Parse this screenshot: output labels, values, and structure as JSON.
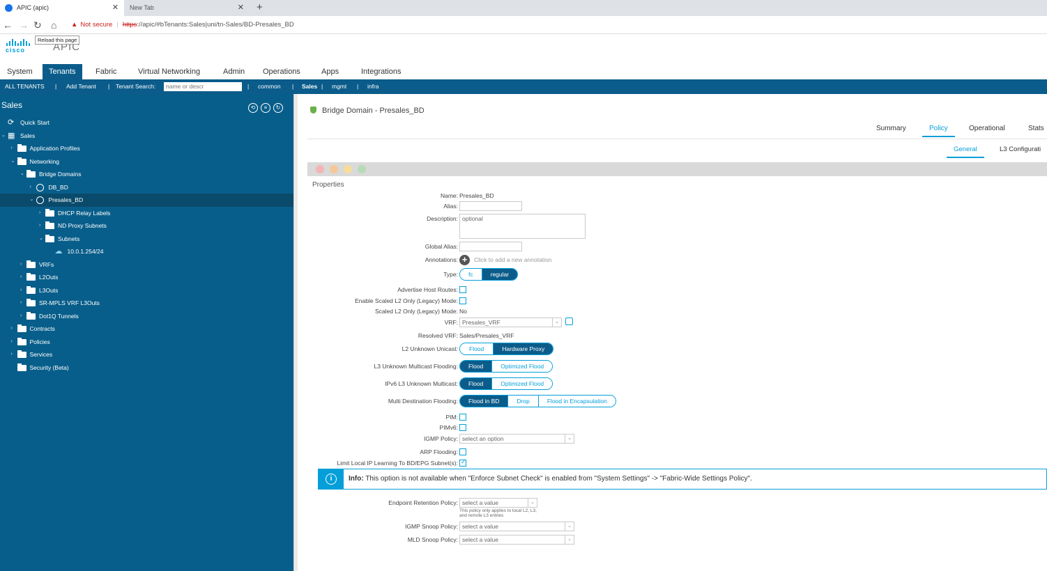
{
  "browser": {
    "tabs": [
      {
        "title": "APIC (apic)"
      },
      {
        "title": "New Tab"
      }
    ],
    "new_tab_symbol": "+",
    "security_label": "Not secure",
    "url_scheme": "https",
    "url_rest": "://apic/#bTenants:Sales|uni/tn-Sales/BD-Presales_BD",
    "tooltip": "Reload this page"
  },
  "app": {
    "logo_text": "cisco",
    "title": "APIC",
    "nav": [
      "System",
      "Tenants",
      "Fabric",
      "Virtual Networking",
      "Admin",
      "Operations",
      "Apps",
      "Integrations"
    ],
    "active_nav": "Tenants"
  },
  "subnav": {
    "all_tenants": "ALL TENANTS",
    "add_tenant": "Add Tenant",
    "search_label": "Tenant Search:",
    "search_placeholder": "name or descr",
    "common": "common",
    "sales": "Sales",
    "mgmt": "mgmt",
    "infra": "infra",
    "sep": "|"
  },
  "sidebar": {
    "title": "Sales",
    "tree": [
      {
        "label": "Quick Start",
        "level": 0,
        "icon": "quickstart-icon",
        "chev": ""
      },
      {
        "label": "Sales",
        "level": 0,
        "icon": "tenant-icon",
        "chev": "v"
      },
      {
        "label": "Application Profiles",
        "level": 1,
        "icon": "folder-icon",
        "chev": ">"
      },
      {
        "label": "Networking",
        "level": 1,
        "icon": "folder-icon",
        "chev": "v"
      },
      {
        "label": "Bridge Domains",
        "level": 2,
        "icon": "folder-icon",
        "chev": "v"
      },
      {
        "label": "DB_BD",
        "level": 3,
        "icon": "bd-icon",
        "chev": ">"
      },
      {
        "label": "Presales_BD",
        "level": 3,
        "icon": "bd-icon",
        "chev": "v",
        "selected": true
      },
      {
        "label": "DHCP Relay Labels",
        "level": 4,
        "icon": "folder-icon",
        "chev": ">"
      },
      {
        "label": "ND Proxy Subnets",
        "level": 4,
        "icon": "folder-icon",
        "chev": ">"
      },
      {
        "label": "Subnets",
        "level": 4,
        "icon": "folder-icon",
        "chev": "v"
      },
      {
        "label": "10.0.1.254/24",
        "level": 5,
        "icon": "cloud-icon",
        "chev": ""
      },
      {
        "label": "VRFs",
        "level": 2,
        "icon": "folder-icon",
        "chev": ">"
      },
      {
        "label": "L2Outs",
        "level": 2,
        "icon": "folder-icon",
        "chev": ">"
      },
      {
        "label": "L3Outs",
        "level": 2,
        "icon": "folder-icon",
        "chev": ">"
      },
      {
        "label": "SR-MPLS VRF L3Outs",
        "level": 2,
        "icon": "folder-icon",
        "chev": ">"
      },
      {
        "label": "Dot1Q Tunnels",
        "level": 2,
        "icon": "folder-icon",
        "chev": ">"
      },
      {
        "label": "Contracts",
        "level": 1,
        "icon": "folder-icon",
        "chev": ">"
      },
      {
        "label": "Policies",
        "level": 1,
        "icon": "folder-icon",
        "chev": ">"
      },
      {
        "label": "Services",
        "level": 1,
        "icon": "folder-icon",
        "chev": ">"
      },
      {
        "label": "Security (Beta)",
        "level": 1,
        "icon": "folder-icon",
        "chev": ""
      }
    ]
  },
  "main": {
    "title": "Bridge Domain - Presales_BD",
    "tabs": [
      "Summary",
      "Policy",
      "Operational",
      "Stats"
    ],
    "active_tab": "Policy",
    "subtabs": [
      "General",
      "L3 Configurati"
    ],
    "active_subtab": "General",
    "properties_title": "Properties",
    "fields": {
      "name_label": "Name:",
      "name_value": "Presales_BD",
      "alias_label": "Alias:",
      "description_label": "Description:",
      "description_placeholder": "optional",
      "global_alias_label": "Global Alias:",
      "annotations_label": "Annotations:",
      "annotations_hint": "Click to add a new annotation",
      "type_label": "Type:",
      "type_options": [
        "fc",
        "regular"
      ],
      "type_selected": "regular",
      "advertise_label": "Advertise Host Routes:",
      "enable_scaled_label": "Enable Scaled L2 Only (Legacy) Mode:",
      "scaled_label": "Scaled L2 Only (Legacy) Mode:",
      "scaled_value": "No",
      "vrf_label": "VRF:",
      "vrf_value": "Presales_VRF",
      "resolved_vrf_label": "Resolved VRF:",
      "resolved_vrf_value": "Sales/Presales_VRF",
      "l2_unknown_label": "L2 Unknown Unicast:",
      "l2_unknown_options": [
        "Flood",
        "Hardware Proxy"
      ],
      "l2_unknown_selected": "Hardware Proxy",
      "l3_multicast_label": "L3 Unknown Multicast Flooding:",
      "l3_multicast_options": [
        "Flood",
        "Optimized Flood"
      ],
      "l3_multicast_selected": "Flood",
      "ipv6_label": "IPv6 L3 Unknown Multicast:",
      "ipv6_options": [
        "Flood",
        "Optimized Flood"
      ],
      "ipv6_selected": "Flood",
      "multi_dest_label": "Multi Destination Flooding:",
      "multi_dest_options": [
        "Flood in BD",
        "Drop",
        "Flood in Encapsulation"
      ],
      "multi_dest_selected": "Flood in BD",
      "pim_label": "PIM:",
      "pimv6_label": "PIMv6:",
      "igmp_policy_label": "IGMP Policy:",
      "igmp_policy_placeholder": "select an option",
      "arp_label": "ARP Flooding:",
      "limit_ip_label": "Limit Local IP Learning To BD/EPG Subnet(s):",
      "limit_ip_checked": true,
      "endpoint_label": "Endpoint Retention Policy:",
      "endpoint_placeholder": "select a value",
      "endpoint_note": "This policy only applies to local L2, L3, and remote L3 entries",
      "igmp_snoop_label": "IGMP Snoop Policy:",
      "igmp_snoop_placeholder": "select a value",
      "mld_snoop_label": "MLD Snoop Policy:",
      "mld_snoop_placeholder": "select a value"
    },
    "info": {
      "prefix": "Info:",
      "text": "This option is not available when \"Enforce Subnet Check\" is enabled from \"System Settings\" -> \"Fabric-Wide Settings Policy\"."
    }
  },
  "colors": {
    "accent": "#049fd9",
    "navy": "#0b5c8a",
    "sidebar": "#085e8a"
  }
}
